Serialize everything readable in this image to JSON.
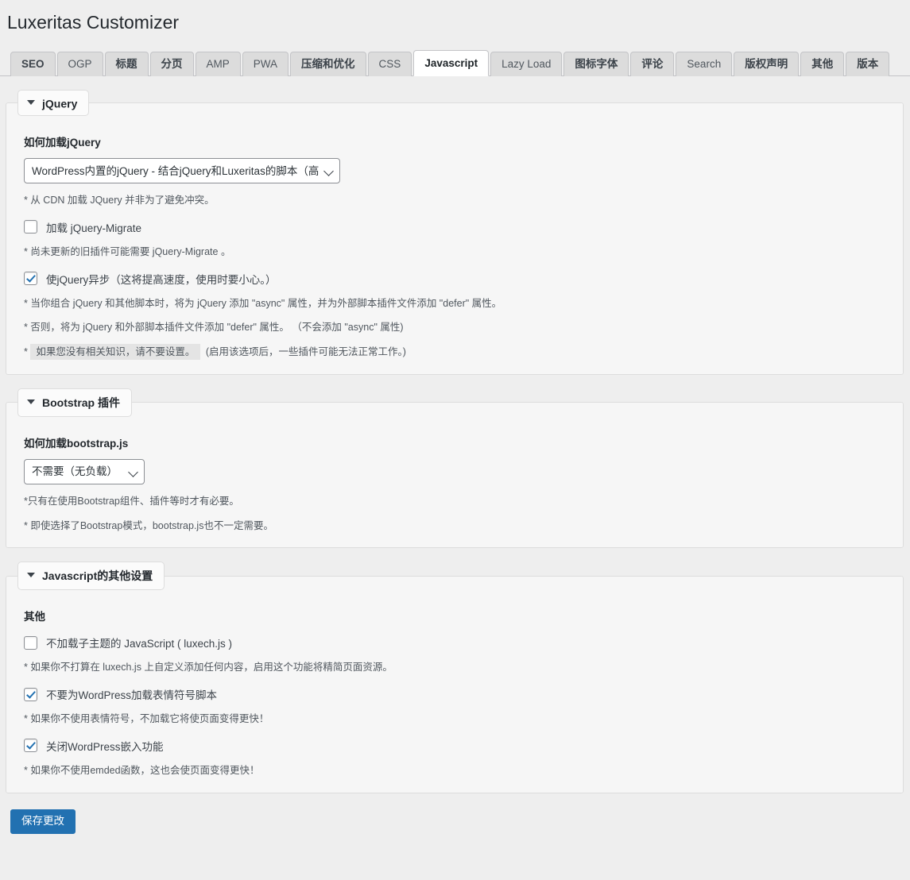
{
  "header": {
    "title": "Luxeritas Customizer"
  },
  "tabs": [
    {
      "label": "SEO",
      "active": false,
      "bold": false
    },
    {
      "label": "OGP",
      "active": false,
      "bold": false
    },
    {
      "label": "标题",
      "active": false,
      "bold": true
    },
    {
      "label": "分页",
      "active": false,
      "bold": true
    },
    {
      "label": "AMP",
      "active": false,
      "bold": false
    },
    {
      "label": "PWA",
      "active": false,
      "bold": false
    },
    {
      "label": "压缩和优化",
      "active": false,
      "bold": true
    },
    {
      "label": "CSS",
      "active": false,
      "bold": false
    },
    {
      "label": "Javascript",
      "active": true,
      "bold": true
    },
    {
      "label": "Lazy Load",
      "active": false,
      "bold": false
    },
    {
      "label": "图标字体",
      "active": false,
      "bold": true
    },
    {
      "label": "评论",
      "active": false,
      "bold": true
    },
    {
      "label": "Search",
      "active": false,
      "bold": false
    },
    {
      "label": "版权声明",
      "active": false,
      "bold": true
    },
    {
      "label": "其他",
      "active": false,
      "bold": true
    },
    {
      "label": "版本",
      "active": false,
      "bold": true
    }
  ],
  "jquery_section": {
    "legend": "jQuery",
    "select_label": "如何加载jQuery",
    "select_value": "WordPress内置的jQuery - 结合jQuery和Luxeritas的脚本（高",
    "note_cdn": "* 从 CDN 加载 JQuery 并非为了避免冲突。",
    "cb_migrate_label": "加载 jQuery-Migrate",
    "cb_migrate_checked": false,
    "note_migrate": "* 尚未更新的旧插件可能需要 jQuery-Migrate 。",
    "cb_async_label": "使jQuery异步（这将提高速度，使用时要小心。）",
    "cb_async_checked": true,
    "note_async_1": "* 当你组合 jQuery 和其他脚本时，将为 jQuery 添加 \"async\" 属性，并为外部脚本插件文件添加 \"defer\" 属性。",
    "note_async_2": "* 否则，将为 jQuery 和外部脚本插件文件添加 \"defer\" 属性。 （不会添加 \"async\" 属性)",
    "note_warn_prefix": "*",
    "note_warn_highlight": "如果您没有相关知识，请不要设置。",
    "note_warn_tail": "(启用该选项后，一些插件可能无法正常工作。)"
  },
  "bootstrap_section": {
    "legend": "Bootstrap 插件",
    "select_label": "如何加载bootstrap.js",
    "select_value": "不需要（无负载）",
    "note_1": "*只有在使用Bootstrap组件、插件等时才有必要。",
    "note_2": "* 即使选择了Bootstrap模式，bootstrap.js也不一定需要。"
  },
  "other_section": {
    "legend": "Javascript的其他设置",
    "group_label": "其他",
    "cb_child_theme_label": "不加载子主题的 JavaScript ( luxech.js )",
    "cb_child_theme_checked": false,
    "note_child_theme": "* 如果你不打算在 luxech.js 上自定义添加任何内容，启用这个功能将精简页面资源。",
    "cb_emoji_label": "不要为WordPress加载表情符号脚本",
    "cb_emoji_checked": true,
    "note_emoji": "* 如果你不使用表情符号，不加载它将使页面变得更快！",
    "cb_embed_label": "关闭WordPress嵌入功能",
    "cb_embed_checked": true,
    "note_embed": "* 如果你不使用emded函数，这也会使页面变得更快！"
  },
  "footer": {
    "save_label": "保存更改"
  },
  "colors": {
    "page_bg": "#eeeeee",
    "panel_bg": "#f6f6f6",
    "accent": "#2271b1",
    "tab_bg": "#dcdcdc",
    "border": "#dddddd"
  }
}
